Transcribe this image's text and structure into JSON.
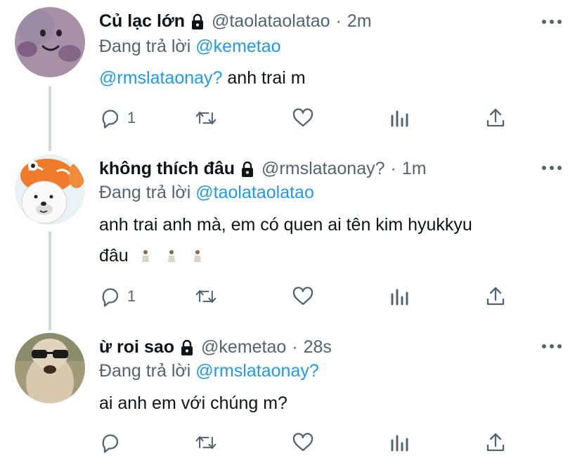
{
  "tweets": [
    {
      "name": "Củ lạc lớn",
      "handle": "@taolataolatao",
      "time": "2m",
      "replying_label": "Đang trả lời",
      "replying_to": "@kemetao",
      "mention": "@rmslataonay?",
      "text": " anh trai m",
      "reply_count": "1",
      "avatar": "purple-plush-face"
    },
    {
      "name": "không thích đâu",
      "handle": "@rmslataonay?",
      "time": "1m",
      "replying_label": "Đang trả lời",
      "replying_to": "@taolataolatao",
      "text_line1": "anh trai anh mà, em có quen ai tên kim hyukkyu",
      "text_line2": "đâu",
      "reply_count": "1",
      "avatar": "bear-with-fish-hat"
    },
    {
      "name": "ừ roi sao",
      "handle": "@kemetao",
      "time": "28s",
      "replying_label": "Đang trả lời",
      "replying_to": "@rmslataonay?",
      "text": "ai anh em với chúng m?",
      "reply_count": "",
      "avatar": "alpaca-with-sunglasses"
    }
  ],
  "icons": {
    "lock": "lock-icon",
    "more": "more-icon",
    "reply": "reply-icon",
    "retweet": "retweet-icon",
    "like": "heart-icon",
    "analytics": "analytics-icon",
    "share": "share-icon"
  },
  "colors": {
    "link": "#1d9bf0",
    "secondary": "#536471",
    "thread_line": "#cfd9de"
  }
}
